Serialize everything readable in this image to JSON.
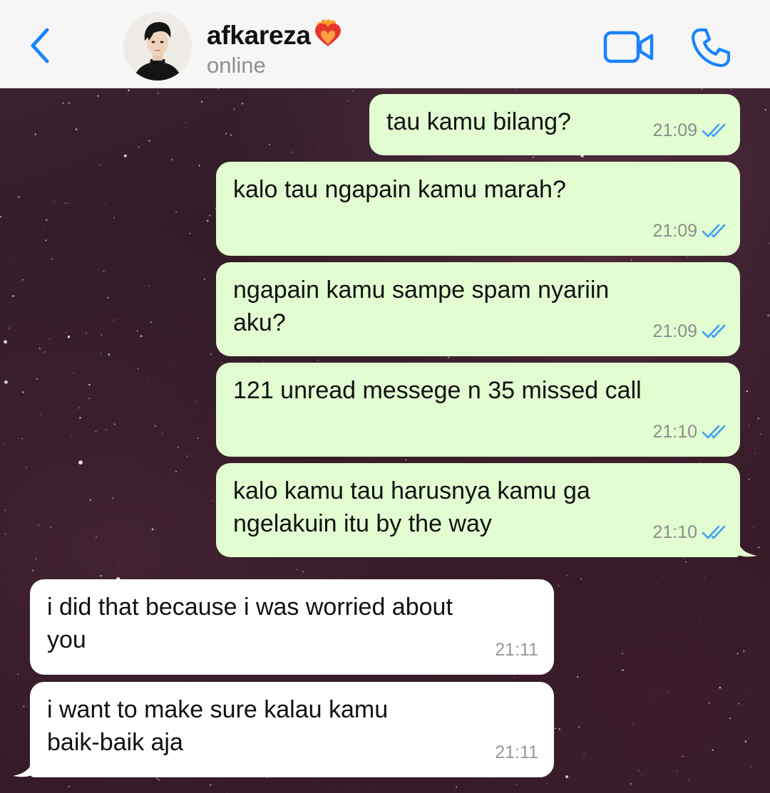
{
  "header": {
    "contact_name": "afkareza",
    "status": "online",
    "back_icon": "chevron-left-icon",
    "video_icon": "video-camera-icon",
    "call_icon": "phone-icon",
    "accent_color": "#1a84ff"
  },
  "messages": [
    {
      "direction": "outgoing",
      "lines": [
        "tau kamu bilang?"
      ],
      "time": "21:09",
      "read": true
    },
    {
      "direction": "outgoing",
      "lines": [
        "kalo tau ngapain kamu marah?"
      ],
      "time": "21:09",
      "read": true
    },
    {
      "direction": "outgoing",
      "lines": [
        "ngapain kamu sampe spam nyariin",
        "aku?"
      ],
      "time": "21:09",
      "read": true
    },
    {
      "direction": "outgoing",
      "lines": [
        "121 unread messege n 35 missed call"
      ],
      "time": "21:10",
      "read": true
    },
    {
      "direction": "outgoing",
      "lines": [
        "kalo kamu tau harusnya kamu ga",
        "ngelakuin itu by the way"
      ],
      "time": "21:10",
      "read": true
    },
    {
      "direction": "incoming",
      "lines": [
        "i did that because i was worried about",
        "you"
      ],
      "time": "21:11"
    },
    {
      "direction": "incoming",
      "lines": [
        "i want to make sure kalau kamu",
        "baik-baik aja"
      ],
      "time": "21:11"
    }
  ],
  "colors": {
    "outgoing_bubble": "#e2fdd1",
    "incoming_bubble": "#ffffff",
    "read_ticks": "#3d9ff5",
    "header_bg": "#f6f6f6"
  }
}
